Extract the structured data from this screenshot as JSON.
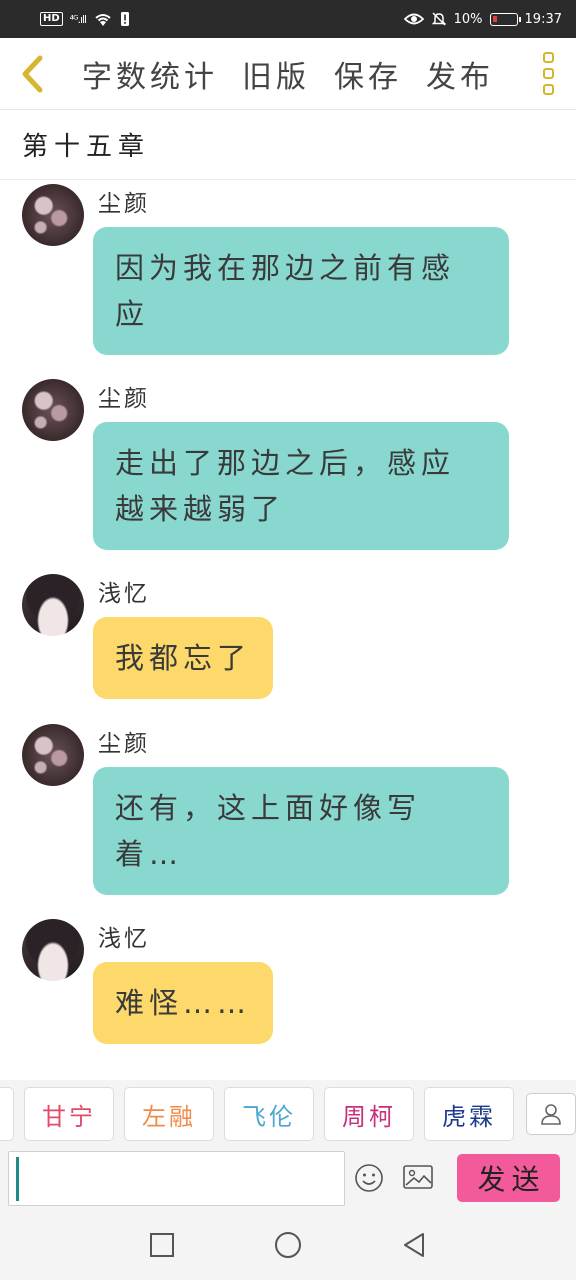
{
  "status_bar": {
    "network": "HD",
    "signal": "⁴ᴳ.ıll",
    "battery_percent": "10%",
    "time": "19:37",
    "battery_level": 0.1
  },
  "toolbar": {
    "back_icon": "chevron-left-icon",
    "items": [
      "字数统计",
      "旧版",
      "保存",
      "发布"
    ],
    "more_icon": "more-vertical-icon",
    "accent_color": "#d6b530"
  },
  "chapter": {
    "title": "第十五章"
  },
  "messages": [
    {
      "sender": "尘颜",
      "text": "因为我在那边之前有感应",
      "bubble_color": "#89d8d0"
    },
    {
      "sender": "尘颜",
      "text": "走出了那边之后，感应越来越弱了",
      "bubble_color": "#89d8d0"
    },
    {
      "sender": "浅忆",
      "text": "我都忘了",
      "bubble_color": "#fdd86a"
    },
    {
      "sender": "尘颜",
      "text": "还有，这上面好像写着…",
      "bubble_color": "#89d8d0"
    },
    {
      "sender": "浅忆",
      "text": "难怪……",
      "bubble_color": "#fdd86a"
    }
  ],
  "characters": [
    {
      "name": "甘宁",
      "color": "#e24a6a"
    },
    {
      "name": "左融",
      "color": "#f08a4a"
    },
    {
      "name": "飞伦",
      "color": "#4aa8d0"
    },
    {
      "name": "周柯",
      "color": "#c8307a"
    },
    {
      "name": "虎霖",
      "color": "#1e3a8a"
    }
  ],
  "input": {
    "value": "",
    "placeholder": ""
  },
  "send_button": {
    "label": "发送",
    "color": "#f25a9a"
  },
  "nav": {
    "icons": [
      "square-icon",
      "circle-icon",
      "triangle-back-icon"
    ]
  }
}
